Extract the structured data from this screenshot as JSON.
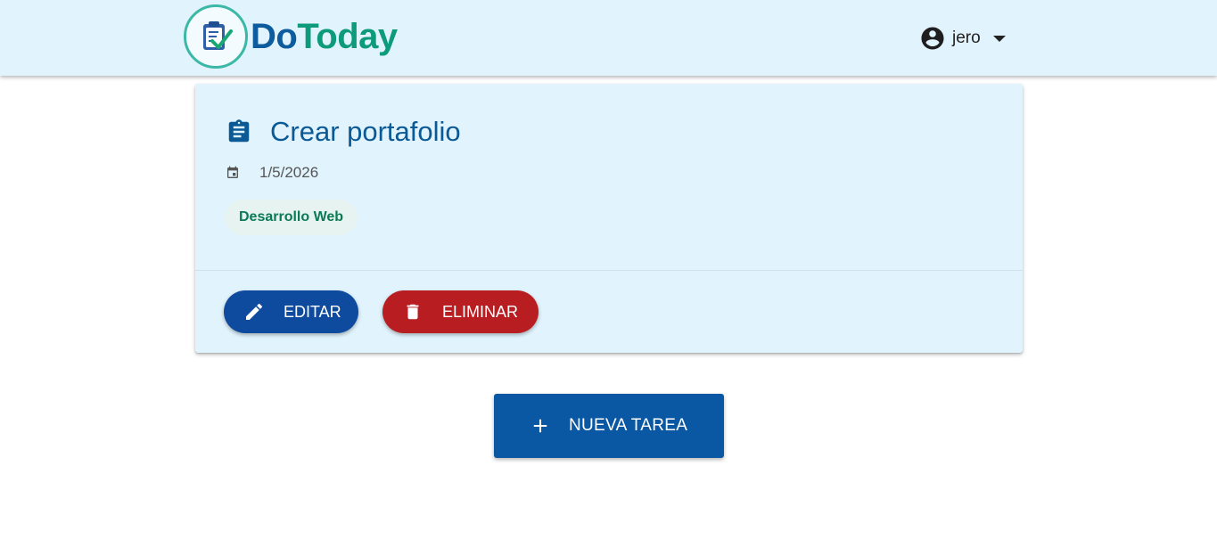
{
  "app": {
    "brand_part1": "Do",
    "brand_part2": "Today",
    "username": "jero"
  },
  "task": {
    "title": "Crear portafolio",
    "date": "1/5/2026",
    "category": "Desarrollo Web",
    "edit_label": "EDITAR",
    "delete_label": "ELIMINAR"
  },
  "actions": {
    "new_task_label": "NUEVA TAREA"
  },
  "icons": {
    "logo": "clipboard-check-icon",
    "user": "account-circle-icon",
    "menu": "caret-down-icon",
    "task": "assignment-icon",
    "date": "calendar-icon",
    "edit": "pencil-icon",
    "delete": "trash-icon",
    "add": "plus-icon"
  },
  "colors": {
    "header_bg": "#e1f3fc",
    "brand_blue": "#0d5c9e",
    "brand_green": "#0e9a7c",
    "edit_button": "#0e4a9e",
    "delete_button": "#b81d21",
    "new_task_button": "#0a58a3",
    "chip_text": "#0b7a55"
  }
}
